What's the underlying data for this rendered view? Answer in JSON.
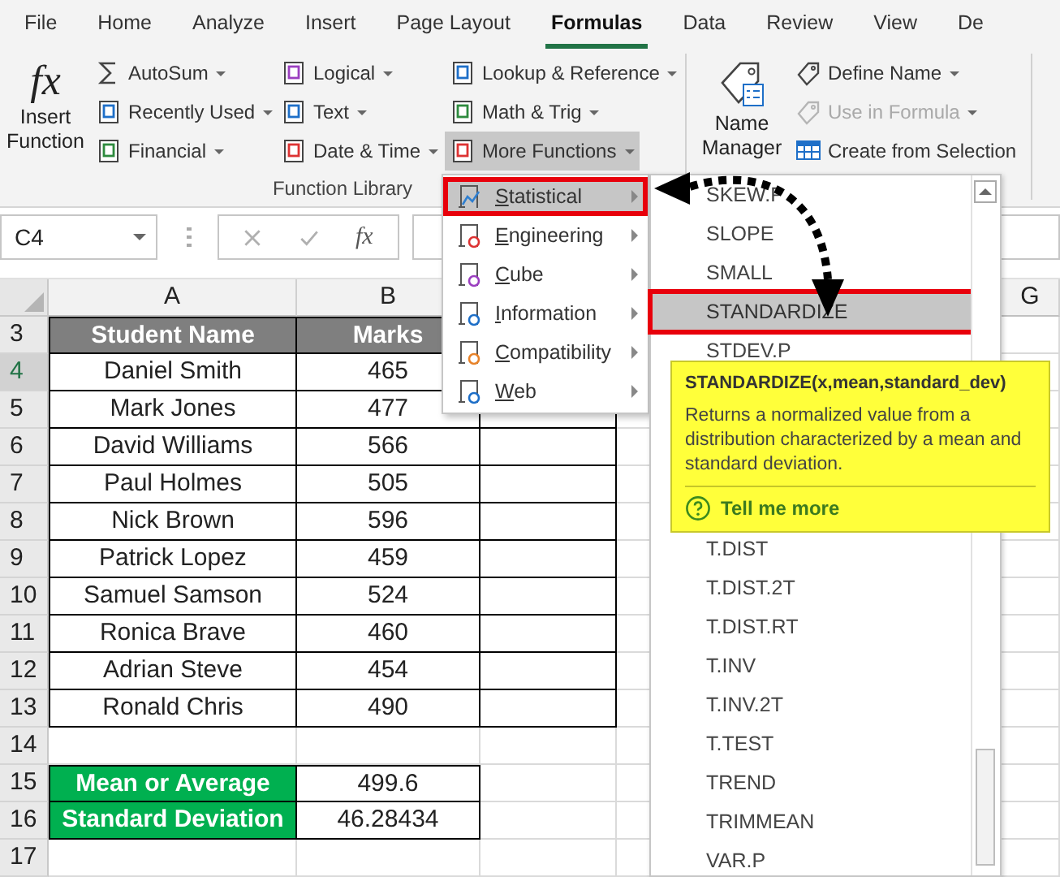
{
  "tabs": [
    {
      "label": "File",
      "selected": false
    },
    {
      "label": "Home",
      "selected": false
    },
    {
      "label": "Analyze",
      "selected": false
    },
    {
      "label": "Insert",
      "selected": false
    },
    {
      "label": "Page Layout",
      "selected": false
    },
    {
      "label": "Formulas",
      "selected": true
    },
    {
      "label": "Data",
      "selected": false
    },
    {
      "label": "Review",
      "selected": false
    },
    {
      "label": "View",
      "selected": false
    },
    {
      "label": "De",
      "selected": false
    }
  ],
  "ribbon": {
    "insert_function": {
      "glyph": "fx",
      "label": "Insert Function"
    },
    "function_library": {
      "label": "Function Library",
      "columns": [
        [
          {
            "label": "AutoSum",
            "dropdown": true,
            "pressed": false
          },
          {
            "label": "Recently Used",
            "dropdown": true,
            "pressed": false
          },
          {
            "label": "Financial",
            "dropdown": true,
            "pressed": false
          }
        ],
        [
          {
            "label": "Logical",
            "dropdown": true,
            "pressed": false
          },
          {
            "label": "Text",
            "dropdown": true,
            "pressed": false
          },
          {
            "label": "Date & Time",
            "dropdown": true,
            "pressed": false
          }
        ],
        [
          {
            "label": "Lookup & Reference",
            "dropdown": true,
            "pressed": false
          },
          {
            "label": "Math & Trig",
            "dropdown": true,
            "pressed": false
          },
          {
            "label": "More Functions",
            "dropdown": true,
            "pressed": true
          }
        ]
      ]
    },
    "name_manager": {
      "label": "Name Manager"
    },
    "defined_names": [
      {
        "label": "Define Name",
        "dropdown": true,
        "disabled": false
      },
      {
        "label": "Use in Formula",
        "dropdown": true,
        "disabled": true
      },
      {
        "label": "Create from Selection",
        "dropdown": false,
        "disabled": false
      }
    ]
  },
  "formula_bar": {
    "name_box": "C4",
    "fx": "fx"
  },
  "sheet": {
    "columns": [
      {
        "label": "A"
      },
      {
        "label": "B"
      },
      {
        "label": "G"
      }
    ],
    "rows": [
      {
        "number": "3",
        "kind": "header",
        "selected": false,
        "cells": [
          "Student Name",
          "Marks"
        ]
      },
      {
        "number": "4",
        "kind": "data",
        "selected": true,
        "cells": [
          "Daniel Smith",
          "465"
        ]
      },
      {
        "number": "5",
        "kind": "data",
        "selected": false,
        "cells": [
          "Mark Jones",
          "477"
        ]
      },
      {
        "number": "6",
        "kind": "data",
        "selected": false,
        "cells": [
          "David Williams",
          "566"
        ]
      },
      {
        "number": "7",
        "kind": "data",
        "selected": false,
        "cells": [
          "Paul Holmes",
          "505"
        ]
      },
      {
        "number": "8",
        "kind": "data",
        "selected": false,
        "cells": [
          "Nick Brown",
          "596"
        ]
      },
      {
        "number": "9",
        "kind": "data",
        "selected": false,
        "cells": [
          "Patrick Lopez",
          "459"
        ]
      },
      {
        "number": "10",
        "kind": "data",
        "selected": false,
        "cells": [
          "Samuel Samson",
          "524"
        ]
      },
      {
        "number": "11",
        "kind": "data",
        "selected": false,
        "cells": [
          "Ronica Brave",
          "460"
        ]
      },
      {
        "number": "12",
        "kind": "data",
        "selected": false,
        "cells": [
          "Adrian Steve",
          "454"
        ]
      },
      {
        "number": "13",
        "kind": "data",
        "selected": false,
        "cells": [
          "Ronald Chris",
          "490"
        ]
      },
      {
        "number": "14",
        "kind": "blank",
        "selected": false,
        "cells": []
      },
      {
        "number": "15",
        "kind": "summary",
        "selected": false,
        "cells": [
          "Mean or Average",
          "499.6"
        ]
      },
      {
        "number": "16",
        "kind": "summary",
        "selected": false,
        "cells": [
          "Standard Deviation",
          "46.28434"
        ]
      },
      {
        "number": "17",
        "kind": "blank",
        "selected": false,
        "cells": []
      }
    ]
  },
  "more_functions_menu": [
    {
      "label": "Statistical",
      "selected": true
    },
    {
      "label": "Engineering",
      "selected": false
    },
    {
      "label": "Cube",
      "selected": false
    },
    {
      "label": "Information",
      "selected": false
    },
    {
      "label": "Compatibility",
      "selected": false
    },
    {
      "label": "Web",
      "selected": false
    }
  ],
  "function_list": {
    "items": [
      {
        "label": "SKEW.P",
        "selected": false
      },
      {
        "label": "SLOPE",
        "selected": false
      },
      {
        "label": "SMALL",
        "selected": false
      },
      {
        "label": "STANDARDIZE",
        "selected": true
      },
      {
        "label": "STDEV.P",
        "selected": false
      }
    ],
    "items_below": [
      {
        "label": "T.DIST",
        "selected": false
      },
      {
        "label": "T.DIST.2T",
        "selected": false
      },
      {
        "label": "T.DIST.RT",
        "selected": false
      },
      {
        "label": "T.INV",
        "selected": false
      },
      {
        "label": "T.INV.2T",
        "selected": false
      },
      {
        "label": "T.TEST",
        "selected": false
      },
      {
        "label": "TREND",
        "selected": false
      },
      {
        "label": "TRIMMEAN",
        "selected": false
      },
      {
        "label": "VAR.P",
        "selected": false
      }
    ]
  },
  "tooltip": {
    "title": "STANDARDIZE(x,mean,standard_dev)",
    "description": "Returns a normalized value from a distribution characterized by a mean and standard deviation.",
    "link": "Tell me more"
  }
}
